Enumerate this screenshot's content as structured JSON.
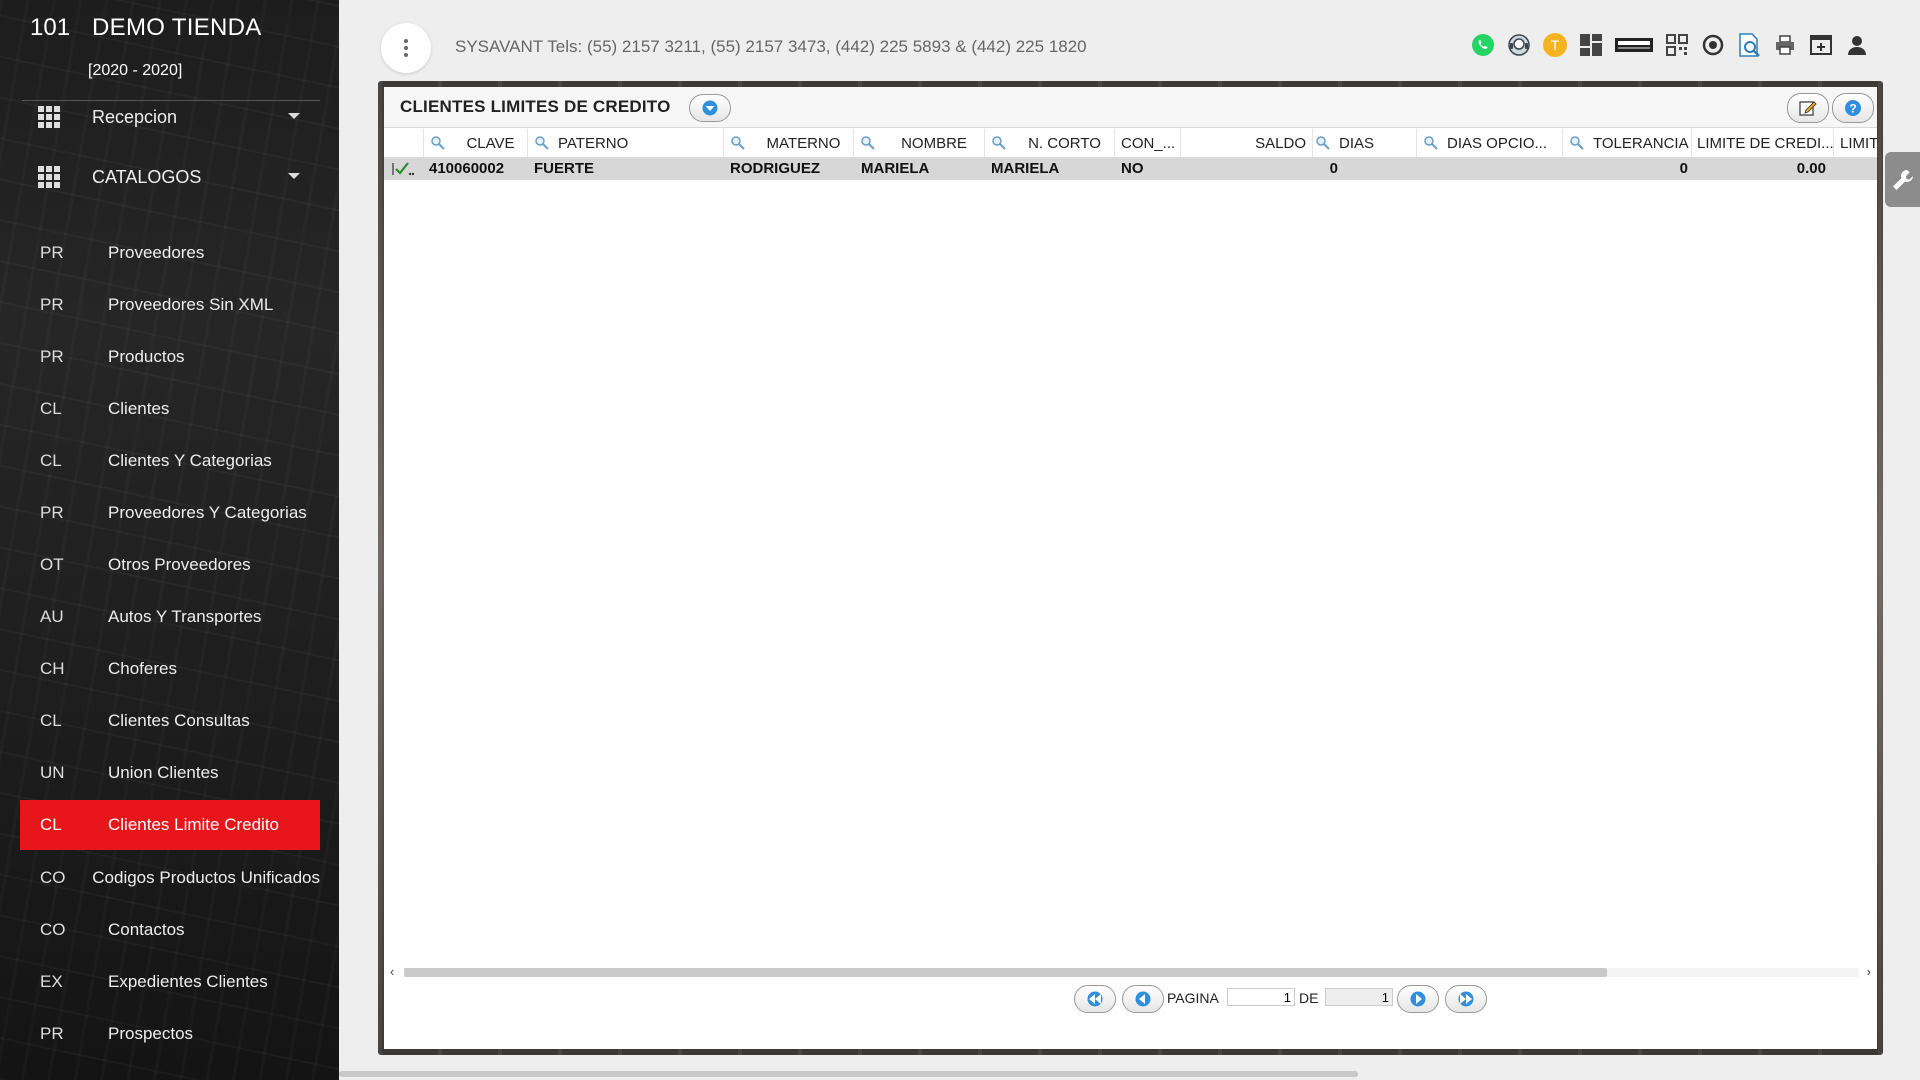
{
  "sidebar": {
    "store_number": "101",
    "store_name": "DEMO TIENDA",
    "years": "[2020 - 2020]",
    "sections": [
      {
        "label": "Recepcion"
      },
      {
        "label": "CATALOGOS"
      }
    ],
    "items": [
      {
        "abbr": "PR",
        "label": "Proveedores"
      },
      {
        "abbr": "PR",
        "label": "Proveedores Sin XML"
      },
      {
        "abbr": "PR",
        "label": "Productos"
      },
      {
        "abbr": "CL",
        "label": "Clientes"
      },
      {
        "abbr": "CL",
        "label": "Clientes Y Categorias"
      },
      {
        "abbr": "PR",
        "label": "Proveedores Y Categorias"
      },
      {
        "abbr": "OT",
        "label": "Otros Proveedores"
      },
      {
        "abbr": "AU",
        "label": "Autos Y Transportes"
      },
      {
        "abbr": "CH",
        "label": "Choferes"
      },
      {
        "abbr": "CL",
        "label": "Clientes Consultas"
      },
      {
        "abbr": "UN",
        "label": "Union Clientes"
      },
      {
        "abbr": "CL",
        "label": "Clientes Limite Credito"
      },
      {
        "abbr": "CO",
        "label": "Codigos Productos Unificados"
      },
      {
        "abbr": "CO",
        "label": "Contactos"
      },
      {
        "abbr": "EX",
        "label": "Expedientes Clientes"
      },
      {
        "abbr": "PR",
        "label": "Prospectos"
      }
    ],
    "active_index": 11,
    "active_color": "#e8151b"
  },
  "topbar": {
    "company_info": "SYSAVANT Tels: (55) 2157 3211, (55) 2157 3473, (442) 225 5893 & (442) 225 1820",
    "t_badge": "T",
    "icons": [
      "whatsapp-icon",
      "support-chat-icon",
      "t-badge-icon",
      "dashboard-icon",
      "xml-icon",
      "qr-code-icon",
      "target-icon",
      "search-document-icon",
      "print-icon",
      "window-add-icon",
      "user-icon"
    ]
  },
  "panel": {
    "title": "CLIENTES LIMITES DE CREDITO",
    "columns": [
      {
        "label": "CLAVE",
        "search": true
      },
      {
        "label": "PATERNO",
        "search": true
      },
      {
        "label": "MATERNO",
        "search": true
      },
      {
        "label": "NOMBRE",
        "search": true
      },
      {
        "label": "N. CORTO",
        "search": true
      },
      {
        "label": "CON_...",
        "search": false
      },
      {
        "label": "SALDO",
        "search": false
      },
      {
        "label": "DIAS",
        "search": true
      },
      {
        "label": "DIAS OPCIO...",
        "search": true
      },
      {
        "label": "TOLERANCIA",
        "search": true
      },
      {
        "label": "LIMITE DE CREDI...",
        "search": false
      },
      {
        "label": "LIMIT",
        "search": false
      }
    ],
    "rows": [
      {
        "clave": "410060002",
        "paterno": "FUERTE",
        "materno": "RODRIGUEZ",
        "nombre": "MARIELA",
        "n_corto": "MARIELA",
        "con": "NO",
        "saldo": "",
        "dias": "0",
        "dias_opcionales": "",
        "tolerancia": "0",
        "limite_credito": "0.00",
        "limit": ""
      }
    ]
  },
  "pager": {
    "page_label": "PAGINA",
    "page_value": "1",
    "of_label": "DE",
    "total_pages": "1"
  }
}
